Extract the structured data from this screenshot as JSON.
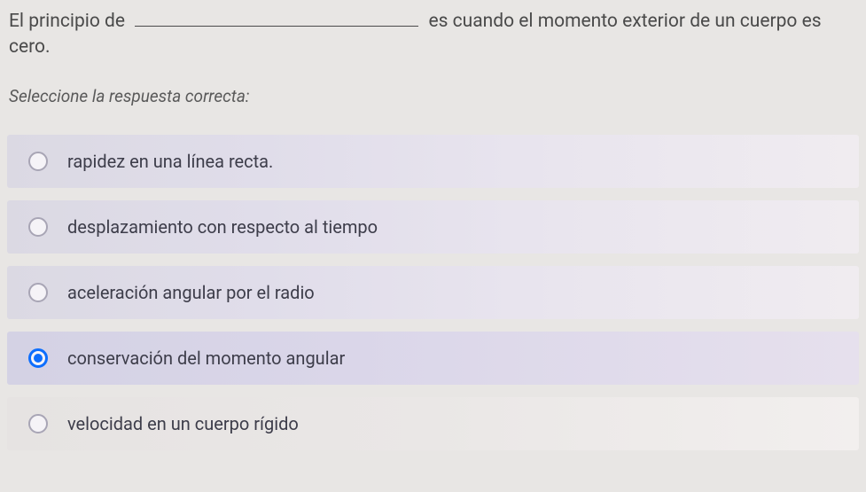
{
  "question": {
    "before_blank": "El principio de",
    "after_blank": "es cuando el momento exterior de un cuerpo es cero."
  },
  "instruction": "Seleccione la respuesta correcta:",
  "options": [
    {
      "label": "rapidez en una línea recta.",
      "selected": false
    },
    {
      "label": "desplazamiento con respecto al tiempo",
      "selected": false
    },
    {
      "label": "aceleración angular por el radio",
      "selected": false
    },
    {
      "label": "conservación del momento angular",
      "selected": true
    },
    {
      "label": "velocidad en un cuerpo rígido",
      "selected": false
    }
  ]
}
